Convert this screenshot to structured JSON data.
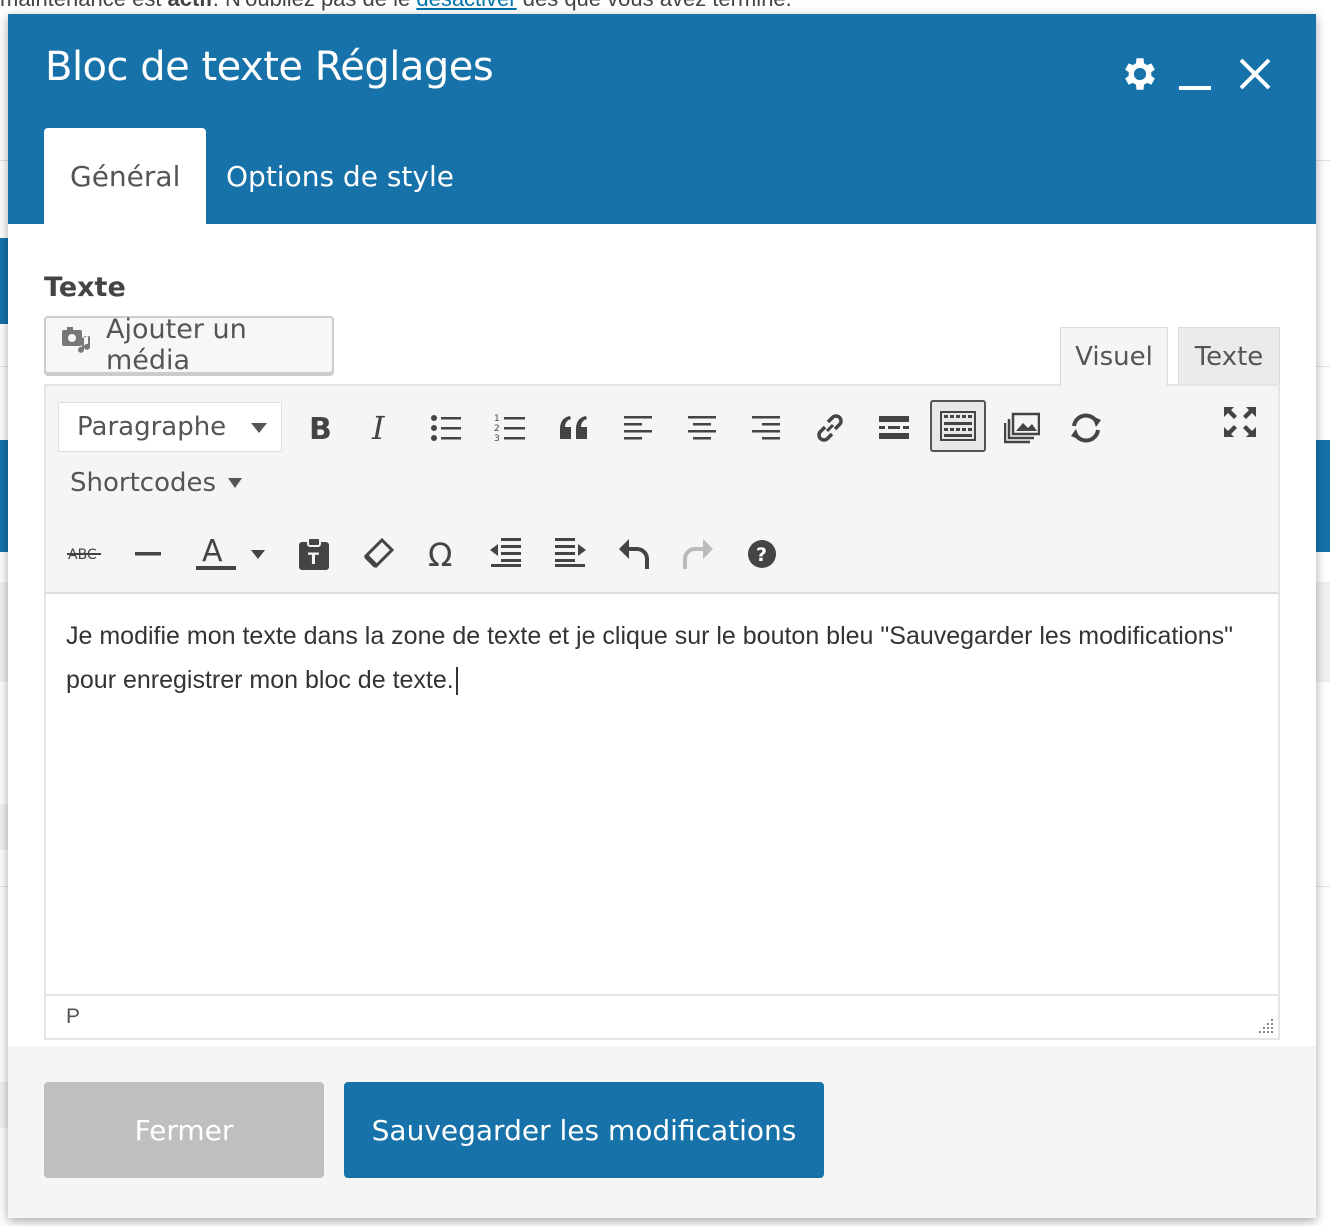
{
  "background": {
    "notice_prefix": "maintenance est ",
    "notice_bold": "actif",
    "notice_middle": ". N'oubliez pas de le ",
    "notice_link": "désactiver",
    "notice_suffix": " dès que vous avez terminé."
  },
  "modal": {
    "title": "Bloc de texte Réglages",
    "tabs": [
      {
        "label": "Général",
        "active": true
      },
      {
        "label": "Options de style",
        "active": false
      }
    ],
    "icons": [
      "gear-icon",
      "minimize-icon",
      "close-icon"
    ]
  },
  "editor": {
    "field_label": "Texte",
    "add_media_label": "Ajouter un média",
    "mode_tabs": {
      "visual": "Visuel",
      "text": "Texte"
    },
    "format_select_value": "Paragraphe",
    "shortcodes_label": "Shortcodes",
    "content": "Je modifie mon texte dans la zone de texte et je clique sur le bouton bleu \"Sauvegarder les modifications\" pour enregistrer mon bloc de texte.",
    "status_path": "P",
    "toolbar_row1": [
      "bold-icon",
      "italic-icon",
      "bullet-list-icon",
      "numbered-list-icon",
      "blockquote-icon",
      "align-left-icon",
      "align-center-icon",
      "align-right-icon",
      "link-icon",
      "read-more-icon",
      "toolbar-toggle-icon",
      "gallery-icon",
      "refresh-icon",
      "fullscreen-icon"
    ],
    "toolbar_row2": [
      "strikethrough-icon",
      "horizontal-line-icon",
      "text-color-icon",
      "paste-text-icon",
      "clear-formatting-icon",
      "special-char-icon",
      "outdent-icon",
      "indent-icon",
      "undo-icon",
      "redo-icon",
      "help-icon"
    ]
  },
  "footer": {
    "close_label": "Fermer",
    "save_label": "Sauvegarder les modifications"
  },
  "colors": {
    "accent": "#1672a9",
    "close_button": "#bfbfbf"
  }
}
